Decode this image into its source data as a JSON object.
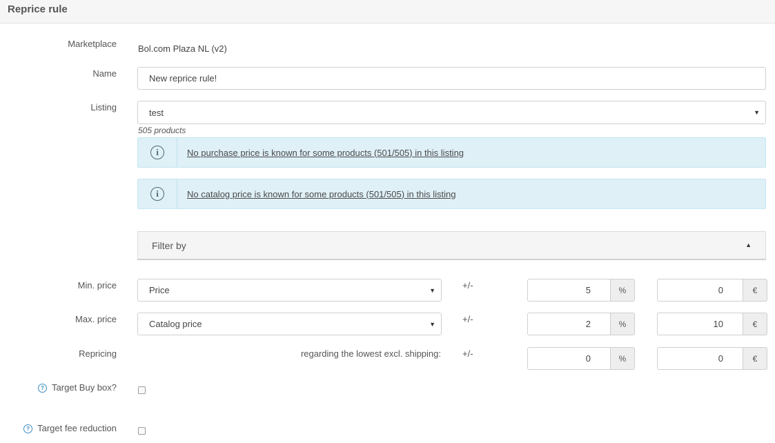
{
  "header": {
    "title": "Reprice rule"
  },
  "form": {
    "marketplace": {
      "label": "Marketplace",
      "value": "Bol.com Plaza NL (v2)"
    },
    "name": {
      "label": "Name",
      "value": "New reprice rule!"
    },
    "listing": {
      "label": "Listing",
      "value": "test",
      "subtext": "505 products"
    },
    "alerts": [
      {
        "icon": "info-icon",
        "text": "No purchase price is known for some products (501/505) in this listing"
      },
      {
        "icon": "info-icon",
        "text": "No catalog price is known for some products (501/505) in this listing"
      }
    ],
    "filter": {
      "label": "Filter by",
      "icon": "caret-up-icon"
    },
    "min_price": {
      "label": "Min. price",
      "select": "Price",
      "plusminus": "+/-",
      "percent": "5",
      "percent_unit": "%",
      "amount": "0",
      "amount_unit": "€"
    },
    "max_price": {
      "label": "Max. price",
      "select": "Catalog price",
      "plusminus": "+/-",
      "percent": "2",
      "percent_unit": "%",
      "amount": "10",
      "amount_unit": "€"
    },
    "repricing": {
      "label": "Repricing",
      "regarding": "regarding the lowest excl. shipping:",
      "plusminus": "+/-",
      "percent": "0",
      "percent_unit": "%",
      "amount": "0",
      "amount_unit": "€"
    },
    "target_buy_box": {
      "label": "Target Buy box?",
      "help_icon": "help-icon",
      "checked": false
    },
    "target_fee_reduction": {
      "label": "Target fee reduction",
      "help_icon": "help-icon",
      "checked": false
    }
  }
}
